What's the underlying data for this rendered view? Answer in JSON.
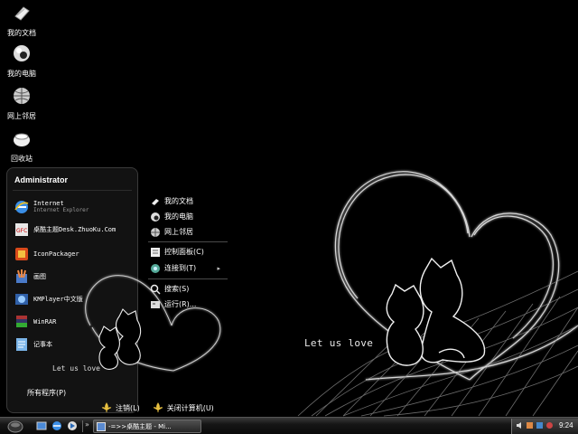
{
  "desktop": {
    "icons": [
      {
        "label": "我的文档",
        "icon": "documents-icon"
      },
      {
        "label": "我的电脑",
        "icon": "computer-icon"
      },
      {
        "label": "网上邻居",
        "icon": "network-icon"
      },
      {
        "label": "回收站",
        "icon": "recycle-bin-icon"
      }
    ],
    "wallpaper_text": "Let us love"
  },
  "start_menu": {
    "user": "Administrator",
    "programs": [
      {
        "line1": "Internet",
        "line2": "Internet Explorer",
        "icon": "internet-explorer-icon"
      },
      {
        "line1": "桌酷主题Desk.ZhuoKu.Com",
        "line2": "",
        "icon": "zhuoku-icon"
      },
      {
        "line1": "IconPackager",
        "line2": "",
        "icon": "iconpackager-icon"
      },
      {
        "line1": "画图",
        "line2": "",
        "icon": "paint-icon"
      },
      {
        "line1": "KMPlayer中文版",
        "line2": "",
        "icon": "kmplayer-icon"
      },
      {
        "line1": "WinRAR",
        "line2": "",
        "icon": "winrar-icon"
      },
      {
        "line1": "记事本",
        "line2": "",
        "icon": "notepad-icon"
      }
    ],
    "love_text": "Let us love",
    "all_programs": "所有程序(P)",
    "right_items": [
      {
        "label": "我的文档",
        "icon": "documents-icon"
      },
      {
        "label": "我的电脑",
        "icon": "computer-icon"
      },
      {
        "label": "网上邻居",
        "icon": "network-icon"
      },
      {
        "label": "控制面板(C)",
        "icon": "control-panel-icon"
      },
      {
        "label": "连接到(T)",
        "icon": "connect-icon"
      },
      {
        "label": "搜索(S)",
        "icon": "search-icon"
      },
      {
        "label": "运行(R)...",
        "icon": "run-icon"
      }
    ],
    "logoff": "注销(L)",
    "shutdown": "关闭计算机(U)"
  },
  "taskbar": {
    "task_label": "-=>>桌酷主题 - Mi...",
    "clock": "9:24"
  },
  "colors": {
    "background": "#000000",
    "menu_panel": "#121212",
    "taskbar": "#161616",
    "text": "#ffffff"
  }
}
